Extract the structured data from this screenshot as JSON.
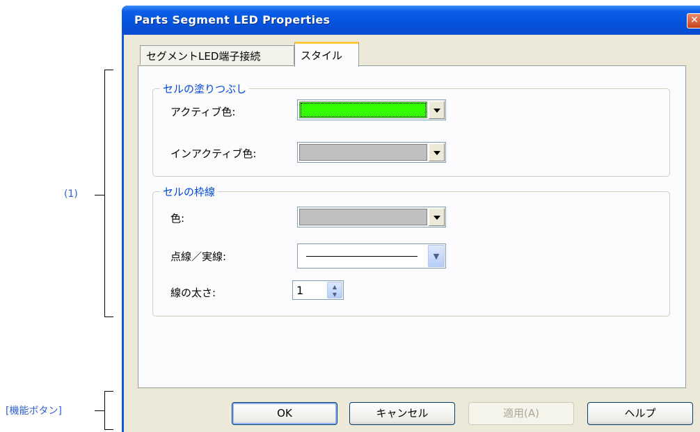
{
  "annotations": {
    "section1_label": "(1)",
    "buttons_label": "[機能ボタン]"
  },
  "window": {
    "title": "Parts Segment LED Properties",
    "close_glyph": "✕"
  },
  "tabs": [
    {
      "label": "セグメントLED端子接続",
      "active": false
    },
    {
      "label": "スタイル",
      "active": true
    }
  ],
  "fill_group": {
    "title": "セルの塗りつぶし",
    "active_color_label": "アクティブ色:",
    "active_color_value": "#33ff00",
    "inactive_color_label": "インアクティブ色:",
    "inactive_color_value": "#c0c0c0"
  },
  "border_group": {
    "title": "セルの枠線",
    "color_label": "色:",
    "color_value": "#c0c0c0",
    "line_style_label": "点線／実線:",
    "line_style_value": "solid",
    "width_label": "線の太さ:",
    "width_value": "1"
  },
  "buttons": {
    "ok": "OK",
    "cancel": "キャンセル",
    "apply": "適用(A)",
    "help": "ヘルプ"
  },
  "icons": {
    "combo_dropdown": "triangle-down-icon",
    "line_dropdown": "chevron-down-icon",
    "spinner": "up-down-arrows-icon"
  }
}
